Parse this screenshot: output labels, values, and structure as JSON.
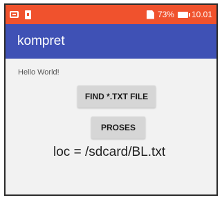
{
  "status_bar": {
    "battery_percent": "73%",
    "time": "10.01",
    "background_color": "#f0522d",
    "icons": [
      "message-icon",
      "sd-card-icon",
      "sim-icon",
      "battery-icon"
    ]
  },
  "app_bar": {
    "title": "kompret",
    "background_color": "#3f51b5"
  },
  "main": {
    "hello_text": "Hello World!",
    "find_button_label": "FIND *.TXT FILE",
    "proses_button_label": "PROSES",
    "location_text": "loc = /sdcard/BL.txt"
  }
}
